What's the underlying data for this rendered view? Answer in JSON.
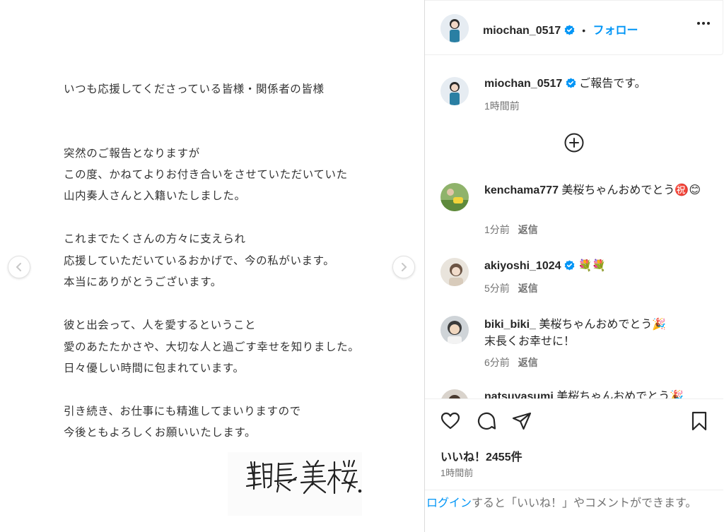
{
  "post_image": {
    "lines": [
      "いつも応援してくださっている皆様・関係者の皆様",
      "突然のご報告となりますが",
      "この度、かねてよりお付き合いをさせていただいていた",
      "山内奏人さんと入籍いたしました。",
      "これまでたくさんの方々に支えられ",
      "応援していただいているおかげで、今の私がいます。",
      "本当にありがとうございます。",
      "彼と出会って、人を愛するということ",
      "愛のあたたかさや、大切な人と過ごす幸せを知りました。",
      "日々優しい時間に包まれています。",
      "引き続き、お仕事にも精進してまいりますので",
      "今後ともよろしくお願いいたします。"
    ],
    "signature": "朝長 美桜."
  },
  "header": {
    "username": "miochan_0517",
    "separator": "•",
    "follow_label": "フォロー"
  },
  "caption": {
    "username": "miochan_0517",
    "text": "ご報告です。",
    "time": "1時間前"
  },
  "comments": [
    {
      "username": "kenchama777",
      "text": "美桜ちゃんおめでとう㊗️😊",
      "time": "1分前",
      "reply": "返信"
    },
    {
      "username": "akiyoshi_1024",
      "text": "💐💐",
      "time": "5分前",
      "reply": "返信"
    },
    {
      "username": "biki_biki_",
      "text": "美桜ちゃんおめでとう🎉",
      "text2": "末長くお幸せに！",
      "time": "6分前",
      "reply": "返信"
    },
    {
      "username": "natsuyasumi",
      "text": "美桜ちゃんおめでとう🎉"
    }
  ],
  "likes": "いいね！2455件",
  "post_time": "1時間前",
  "login_prompt": {
    "link": "ログイン",
    "rest": "すると「いいね！」やコメントができます。"
  },
  "colors": {
    "accent": "#0095f6",
    "verified": "#0095f6",
    "muted": "#737373"
  }
}
